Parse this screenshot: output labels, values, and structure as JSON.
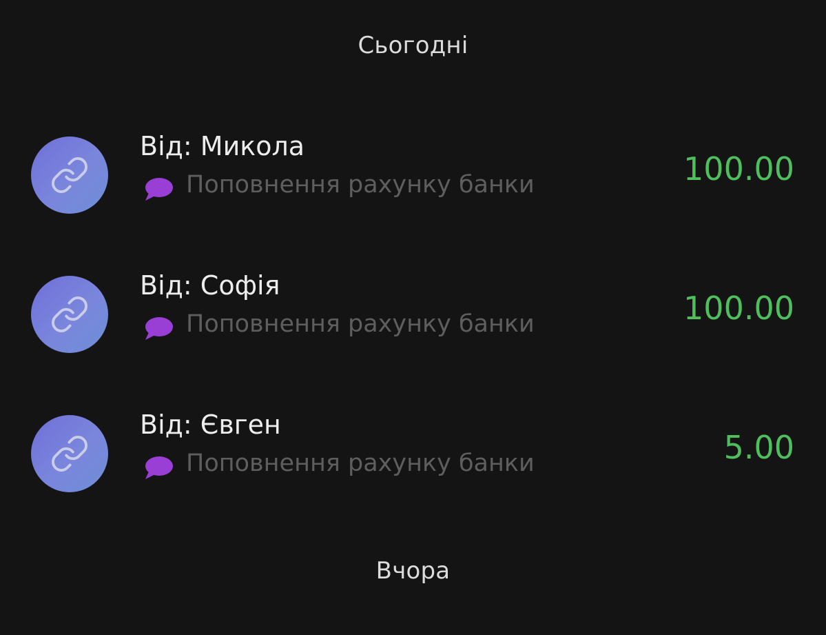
{
  "sections": {
    "today": "Сьогодні",
    "yesterday": "Вчора"
  },
  "transactions": [
    {
      "sender": "Від: Микола",
      "note": "Поповнення рахунку банки",
      "amount": "100.00",
      "avatar_icon": "link-icon",
      "note_icon": "speech-bubble-icon"
    },
    {
      "sender": "Від: Софія",
      "note": "Поповнення рахунку банки",
      "amount": "100.00",
      "avatar_icon": "link-icon",
      "note_icon": "speech-bubble-icon"
    },
    {
      "sender": "Від: Євген",
      "note": "Поповнення рахунку банки",
      "amount": "5.00",
      "avatar_icon": "link-icon",
      "note_icon": "speech-bubble-icon"
    }
  ],
  "colors": {
    "background": "#141414",
    "amount_positive": "#4fbf5e",
    "avatar": "#7379da",
    "note_icon": "#9a3fd6",
    "note_text": "#5e5e5e"
  }
}
